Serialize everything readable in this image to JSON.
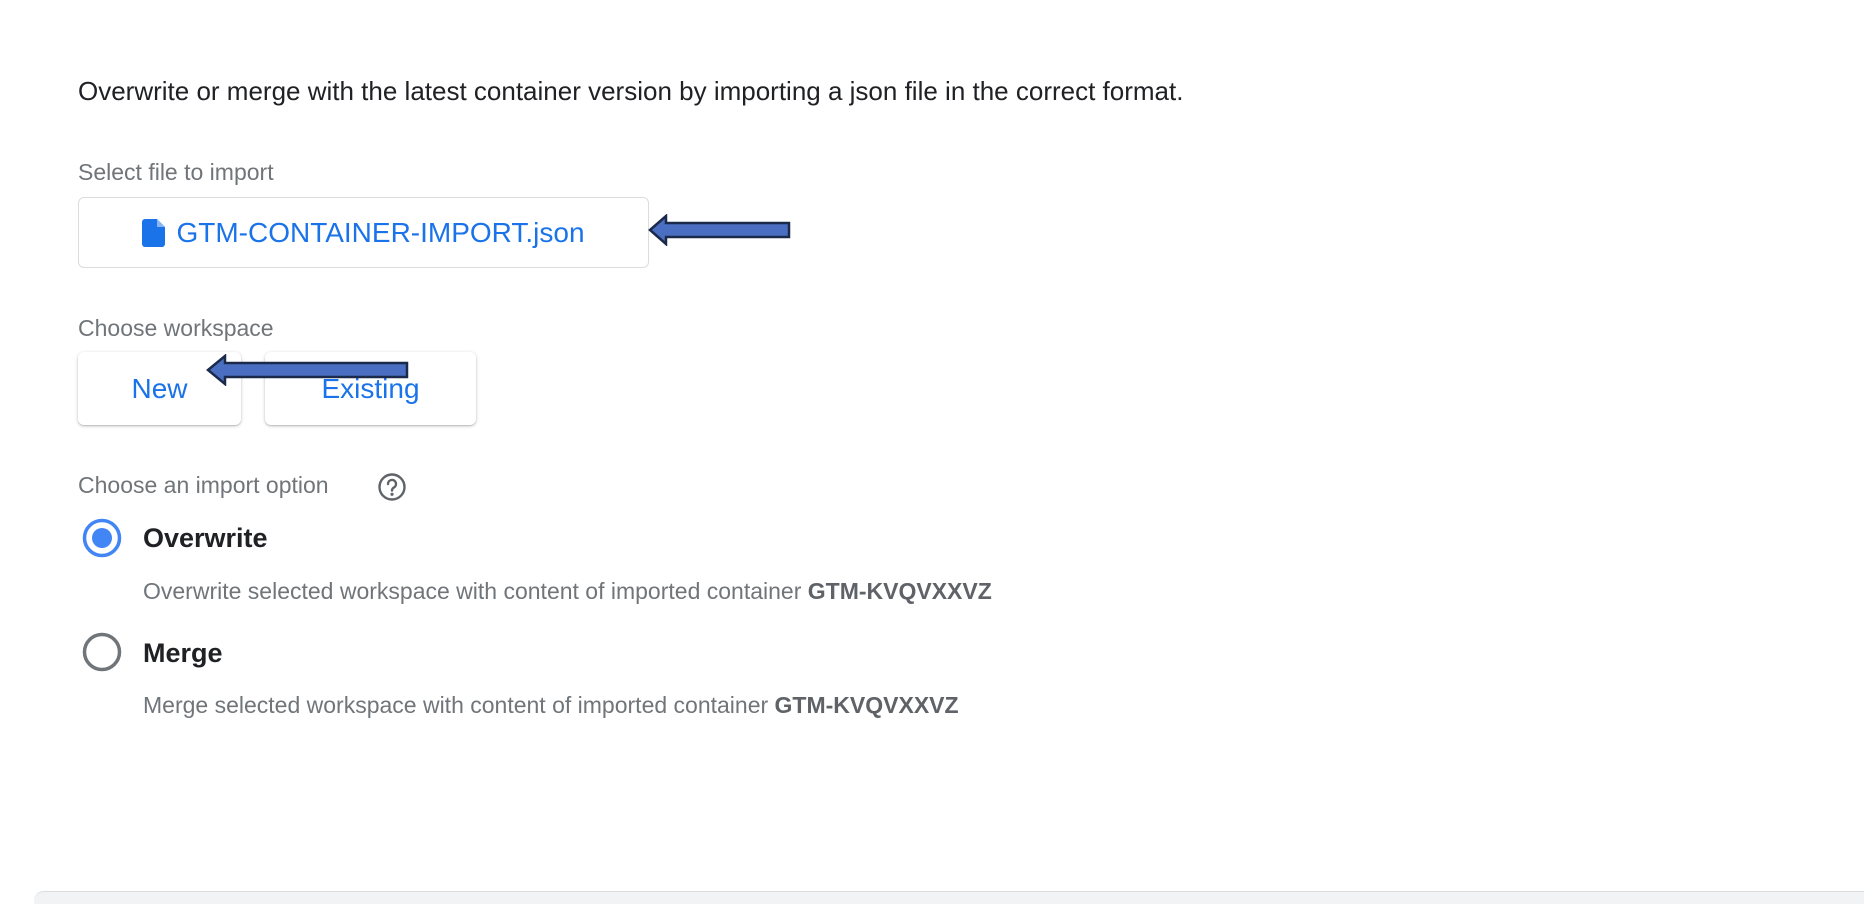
{
  "intro_text": "Overwrite or merge with the latest container version by importing a json file in the correct format.",
  "file_section": {
    "label": "Select file to import",
    "file_name": "GTM-CONTAINER-IMPORT.json",
    "file_icon": "file-icon"
  },
  "workspace_section": {
    "label": "Choose workspace",
    "buttons": [
      {
        "label": "New"
      },
      {
        "label": "Existing"
      }
    ]
  },
  "import_section": {
    "label": "Choose an import option",
    "help_icon": "help-circle-icon",
    "options": [
      {
        "title": "Overwrite",
        "desc_prefix": "Overwrite selected workspace with content of imported container ",
        "container_id": "GTM-KVQVXXVZ",
        "selected": true
      },
      {
        "title": "Merge",
        "desc_prefix": "Merge selected workspace with content of imported container ",
        "container_id": "GTM-KVQVXXVZ",
        "selected": false
      }
    ]
  },
  "colors": {
    "accent": "#1a73e8",
    "radio_selected": "#4285f4",
    "arrow_fill": "#4a6fc2",
    "arrow_stroke": "#1b2a4a"
  }
}
